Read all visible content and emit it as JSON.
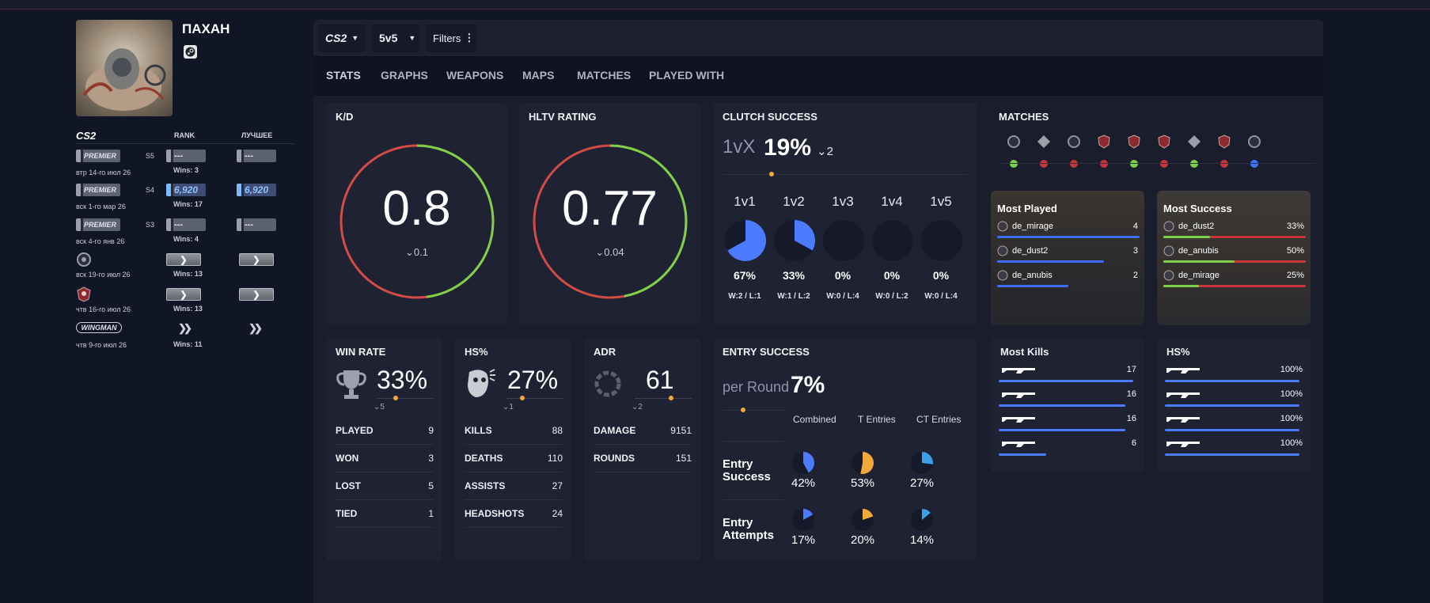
{
  "profile": {
    "name": "ПАХАН"
  },
  "ranks": {
    "game_logo": "CS2",
    "col_rank": "RANK",
    "col_best": "ЛУЧШЕЕ",
    "rows": [
      {
        "badge": "PREMIER",
        "season": "S5",
        "date": "втр 14-го июл 26",
        "rank": "---",
        "wins": "Wins: 3",
        "best": "---"
      },
      {
        "badge": "PREMIER",
        "season": "S4",
        "date": "вск 1-го мар 26",
        "rank": "6,920",
        "wins": "Wins: 17",
        "best": "6,920"
      },
      {
        "badge": "PREMIER",
        "season": "S3",
        "date": "вск 4-го янв 26",
        "rank": "---",
        "wins": "Wins: 4",
        "best": "---"
      },
      {
        "date": "вск 19-го июл 26",
        "wins": "Wins: 13"
      },
      {
        "date": "чтв 16-го июл 26",
        "wins": "Wins: 13"
      },
      {
        "badge": "WINGMAN",
        "date": "чтв 9-го июл 26",
        "wins": "Wins: 11"
      }
    ]
  },
  "controls": {
    "game": "CS2",
    "mode": "5v5",
    "filters": "Filters"
  },
  "tabs": [
    "STATS",
    "GRAPHS",
    "WEAPONS",
    "MAPS",
    "MATCHES",
    "PLAYED WITH"
  ],
  "kd": {
    "title": "K/D",
    "value": "0.8",
    "delta": "0.1",
    "ratio": 0.48
  },
  "hltv": {
    "title": "HLTV RATING",
    "value": "0.77",
    "delta": "0.04",
    "ratio": 0.47
  },
  "clutch": {
    "title": "CLUTCH SUCCESS",
    "prefix": "1vX",
    "value": "19%",
    "delta": "2",
    "cols": [
      {
        "label": "1v1",
        "pct": "67%",
        "wl": "W:2 / L:1",
        "frac": 0.67
      },
      {
        "label": "1v2",
        "pct": "33%",
        "wl": "W:1 / L:2",
        "frac": 0.33
      },
      {
        "label": "1v3",
        "pct": "0%",
        "wl": "W:0 / L:4",
        "frac": 0
      },
      {
        "label": "1v4",
        "pct": "0%",
        "wl": "W:0 / L:2",
        "frac": 0
      },
      {
        "label": "1v5",
        "pct": "0%",
        "wl": "W:0 / L:4",
        "frac": 0
      }
    ]
  },
  "matches": {
    "title": "MATCHES",
    "results": [
      "win",
      "loss",
      "loss",
      "loss",
      "win",
      "loss",
      "win",
      "loss",
      "other"
    ]
  },
  "most_played": {
    "title": "Most Played",
    "items": [
      {
        "map": "de_mirage",
        "value": "4",
        "frac": 1.0
      },
      {
        "map": "de_dust2",
        "value": "3",
        "frac": 0.75
      },
      {
        "map": "de_anubis",
        "value": "2",
        "frac": 0.5
      }
    ]
  },
  "most_success": {
    "title": "Most Success",
    "items": [
      {
        "map": "de_dust2",
        "value": "33%",
        "frac": 0.33
      },
      {
        "map": "de_anubis",
        "value": "50%",
        "frac": 0.5
      },
      {
        "map": "de_mirage",
        "value": "25%",
        "frac": 0.25
      }
    ]
  },
  "winrate": {
    "title": "WIN RATE",
    "value": "33%",
    "delta": "5",
    "rows": [
      {
        "k": "PLAYED",
        "v": "9"
      },
      {
        "k": "WON",
        "v": "3"
      },
      {
        "k": "LOST",
        "v": "5"
      },
      {
        "k": "TIED",
        "v": "1"
      }
    ]
  },
  "hs": {
    "title": "HS%",
    "value": "27%",
    "delta": "1",
    "rows": [
      {
        "k": "KILLS",
        "v": "88"
      },
      {
        "k": "DEATHS",
        "v": "110"
      },
      {
        "k": "ASSISTS",
        "v": "27"
      },
      {
        "k": "HEADSHOTS",
        "v": "24"
      }
    ]
  },
  "adr": {
    "title": "ADR",
    "value": "61",
    "delta": "2",
    "rows": [
      {
        "k": "DAMAGE",
        "v": "9151"
      },
      {
        "k": "ROUNDS",
        "v": "151"
      }
    ]
  },
  "entry": {
    "title": "ENTRY SUCCESS",
    "prefix": "per Round",
    "value": "7%",
    "cols": [
      "Combined",
      "T Entries",
      "CT Entries"
    ],
    "success_label": "Entry Success",
    "attempts_label": "Entry Attempts",
    "success": [
      {
        "pct": "42%",
        "frac": 0.42,
        "color": "#4d7bff"
      },
      {
        "pct": "53%",
        "frac": 0.53,
        "color": "#f2a93b"
      },
      {
        "pct": "27%",
        "frac": 0.27,
        "color": "#3aa0e8"
      }
    ],
    "attempts": [
      {
        "pct": "17%",
        "frac": 0.17,
        "color": "#4d7bff"
      },
      {
        "pct": "20%",
        "frac": 0.2,
        "color": "#f2a93b"
      },
      {
        "pct": "14%",
        "frac": 0.14,
        "color": "#3aa0e8"
      }
    ]
  },
  "most_kills": {
    "title": "Most Kills",
    "items": [
      {
        "weapon": "awp-icon",
        "value": "17",
        "frac": 1.0
      },
      {
        "weapon": "m4-icon",
        "value": "16",
        "frac": 0.94
      },
      {
        "weapon": "ak47-icon",
        "value": "16",
        "frac": 0.94
      },
      {
        "weapon": "pistol-icon",
        "value": "6",
        "frac": 0.35
      }
    ]
  },
  "hs_weapons": {
    "title": "HS%",
    "items": [
      {
        "weapon": "deagle-icon",
        "value": "100%"
      },
      {
        "weapon": "famas-icon",
        "value": "100%"
      },
      {
        "weapon": "mp9-icon",
        "value": "100%"
      },
      {
        "weapon": "dual-pistols-icon",
        "value": "100%"
      }
    ]
  },
  "colors": {
    "green": "#7dd14a",
    "red": "#d24b45",
    "blue": "#4d7bff",
    "orange": "#f2a93b",
    "panel": "#1e2233"
  }
}
